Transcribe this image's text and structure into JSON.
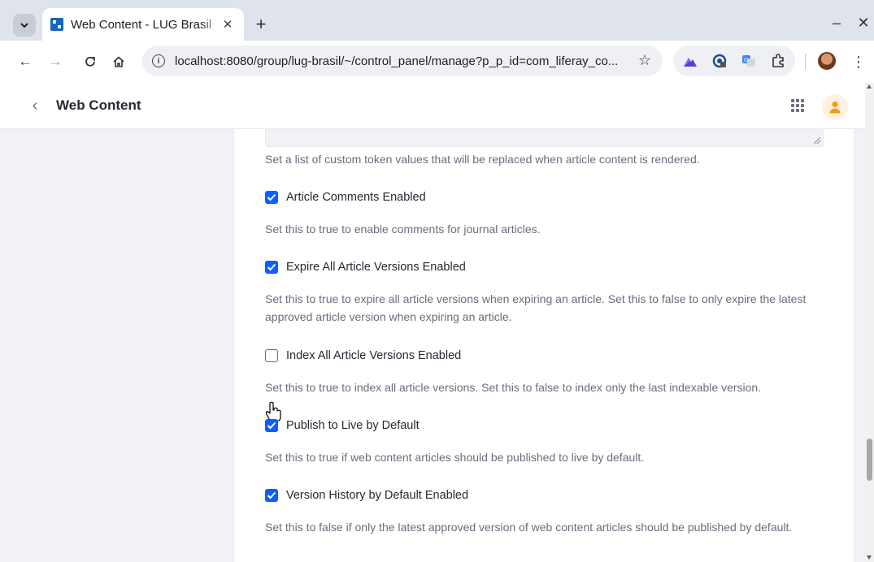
{
  "browser": {
    "tab": {
      "title": "Web Content - LUG Brasil"
    },
    "url": "localhost:8080/group/lug-brasil/~/control_panel/manage?p_p_id=com_liferay_co..."
  },
  "header": {
    "title": "Web Content"
  },
  "settings": {
    "token_help": "Set a list of custom token values that will be replaced when article content is rendered.",
    "items": [
      {
        "label": "Article Comments Enabled",
        "checked": true,
        "help": "Set this to true to enable comments for journal articles."
      },
      {
        "label": "Expire All Article Versions Enabled",
        "checked": true,
        "help": "Set this to true to expire all article versions when expiring an article. Set this to false to only expire the latest approved article version when expiring an article."
      },
      {
        "label": "Index All Article Versions Enabled",
        "checked": false,
        "help": "Set this to true to index all article versions. Set this to false to index only the last indexable version."
      },
      {
        "label": "Publish to Live by Default",
        "checked": true,
        "help": "Set this to true if web content articles should be published to live by default."
      },
      {
        "label": "Version History by Default Enabled",
        "checked": true,
        "help": "Set this to false if only the latest approved version of web content articles should be published by default."
      }
    ]
  },
  "colors": {
    "accent": "#0b5fff",
    "title": "#272833",
    "muted": "#6b6c7e"
  }
}
